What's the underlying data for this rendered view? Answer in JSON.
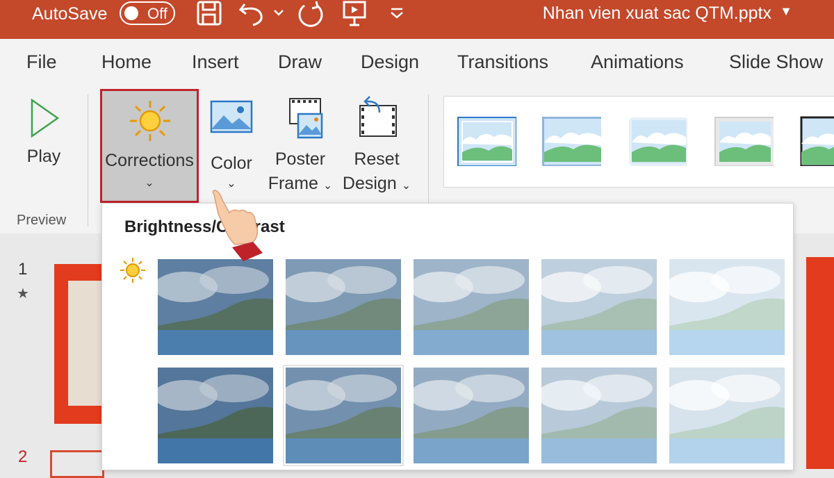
{
  "titlebar": {
    "autosave_label": "AutoSave",
    "toggle_state": "Off",
    "filename": "Nhan vien xuat sac QTM.pptx"
  },
  "tabs": [
    "File",
    "Home",
    "Insert",
    "Draw",
    "Design",
    "Transitions",
    "Animations",
    "Slide Show"
  ],
  "ribbon": {
    "play_label": "Play",
    "preview_group_label": "Preview",
    "corrections_label": "Corrections",
    "color_label": "Color",
    "poster_frame_line1": "Poster",
    "poster_frame_line2": "Frame",
    "reset_design_line1": "Reset",
    "reset_design_line2": "Design"
  },
  "slides": {
    "numbers": [
      "1",
      "2"
    ],
    "star": "★"
  },
  "dropdown": {
    "section_title": "Brightness/Contrast",
    "rows": [
      [
        {
          "brightness": 0.3,
          "contrast": 0.7
        },
        {
          "brightness": 0.45,
          "contrast": 0.6
        },
        {
          "brightness": 0.6,
          "contrast": 0.5
        },
        {
          "brightness": 0.75,
          "contrast": 0.4
        },
        {
          "brightness": 0.88,
          "contrast": 0.3
        }
      ],
      [
        {
          "brightness": 0.25,
          "contrast": 0.85
        },
        {
          "brightness": 0.4,
          "contrast": 0.8,
          "selected": true
        },
        {
          "brightness": 0.55,
          "contrast": 0.75
        },
        {
          "brightness": 0.72,
          "contrast": 0.65
        },
        {
          "brightness": 0.86,
          "contrast": 0.55
        }
      ]
    ]
  },
  "colors": {
    "titlebar": "#c4482a",
    "highlight": "#c0222a",
    "sun": "#f5b800"
  }
}
